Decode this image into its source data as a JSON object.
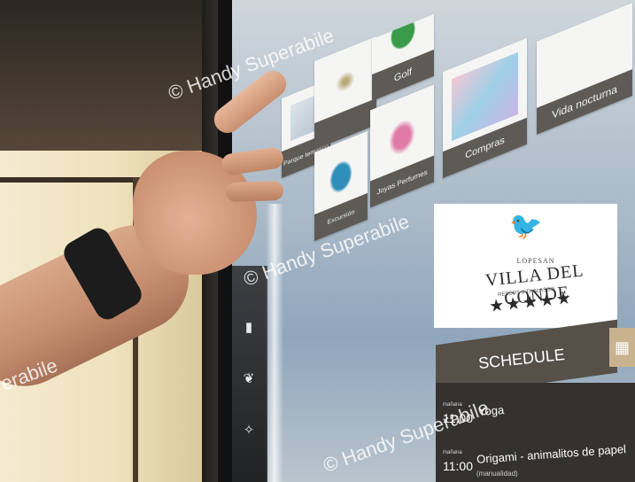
{
  "tiles": [
    {
      "label": "Parque temático"
    },
    {
      "label": "Golf"
    },
    {
      "label": "Vida nocturna"
    },
    {
      "label": "Compras"
    },
    {
      "label": "Joyas Perfumes"
    },
    {
      "label": "Excursión"
    }
  ],
  "hotel": {
    "brand": "LOPESAN",
    "name": "VILLA DEL CONDE",
    "tagline": "RESORT & THALASSO",
    "stars": "★★★★★"
  },
  "schedule": {
    "title": "SCHEDULE",
    "rows": [
      {
        "day": "mañana",
        "time": "11:00",
        "title": "Yoga",
        "sub": ""
      },
      {
        "day": "mañana",
        "time": "11:00",
        "title": "Origami - animalitos de papel",
        "sub": "(manualidad)"
      }
    ]
  },
  "watermark": "© Handy Superabile",
  "watermark_partial": "erabile"
}
